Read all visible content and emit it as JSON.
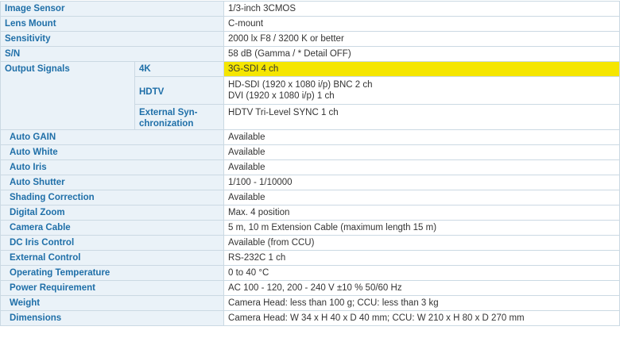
{
  "specs": {
    "image_sensor": {
      "label": "Image Sensor",
      "value": "1/3-inch 3CMOS"
    },
    "lens_mount": {
      "label": "Lens Mount",
      "value": "C-mount"
    },
    "sensitivity": {
      "label": "Sensitivity",
      "value": "2000 lx F8 / 3200 K or better"
    },
    "sn": {
      "label": "S/N",
      "value": "58 dB (Gamma / * Detail OFF)"
    },
    "output_signals": {
      "label": "Output Signals",
      "k4": {
        "label": "4K",
        "value": "3G-SDI 4 ch",
        "highlight_color": "#f5e600"
      },
      "hdtv": {
        "label": "HDTV",
        "value_line1": "HD-SDI (1920 x 1080 i/p) BNC 2 ch",
        "value_line2": "DVI (1920 x 1080 i/p) 1 ch"
      },
      "ext_sync": {
        "label_line1": "External Syn-",
        "label_line2": "chronization",
        "value": "HDTV Tri-Level SYNC 1 ch"
      }
    },
    "auto_gain": {
      "label": "Auto GAIN",
      "value": "Available"
    },
    "auto_white": {
      "label": "Auto White",
      "value": "Available"
    },
    "auto_iris": {
      "label": "Auto Iris",
      "value": "Available"
    },
    "auto_shutter": {
      "label": "Auto Shutter",
      "value": "1/100 - 1/10000"
    },
    "shading_correction": {
      "label": "Shading Correction",
      "value": "Available"
    },
    "digital_zoom": {
      "label": "Digital Zoom",
      "value": "Max. 4 position"
    },
    "camera_cable": {
      "label": "Camera Cable",
      "value": "5 m, 10 m Extension Cable (maximum length 15 m)"
    },
    "dc_iris_control": {
      "label": "DC Iris Control",
      "value": "Available (from CCU)"
    },
    "external_control": {
      "label": "External Control",
      "value": "RS-232C 1 ch"
    },
    "operating_temperature": {
      "label": "Operating Temperature",
      "value": "0 to 40 °C"
    },
    "power_requirement": {
      "label": "Power Requirement",
      "value": "AC 100 - 120, 200 - 240 V ±10 % 50/60 Hz"
    },
    "weight": {
      "label": "Weight",
      "value": "Camera Head: less than 100 g; CCU: less than 3 kg"
    },
    "dimensions": {
      "label": "Dimensions",
      "value": "Camera Head: W 34 x H 40 x D 40 mm; CCU: W 210 x H 80 x D 270 mm"
    }
  },
  "colors": {
    "label_text": "#1f6fa8",
    "label_bg": "#eaf2f8",
    "border": "#cbd9e3",
    "highlight": "#f5e600"
  }
}
